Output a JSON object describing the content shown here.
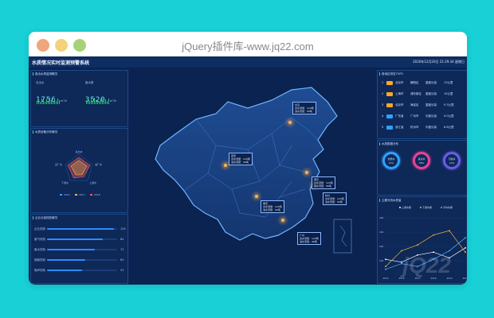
{
  "window": {
    "title": "jQuery插件库-www.jq22.com"
  },
  "header": {
    "title": "水质情况实时监测预警系统",
    "time": "2020年12月20日   21:29:34  星期日"
  },
  "left": {
    "panel1": {
      "title": "各出水质监测概况",
      "col1_label": "总出水",
      "col2_label": "废水数",
      "col1_value": "1756",
      "col1_unit": "m³/h",
      "col2_value": "3520",
      "col2_unit": "m³/h"
    },
    "panel2": {
      "title": "水质设备分布情况",
      "axes": [
        "总出水",
        "进厂水",
        "上游水",
        "下游水",
        "出厂水"
      ],
      "legend": [
        "2015",
        "2017",
        "2018"
      ]
    },
    "panel3": {
      "title": "企业污染排放情况",
      "rows": [
        {
          "label": "企业排放",
          "value": "100",
          "ratio": 0.95
        },
        {
          "label": "废气排放",
          "value": "84",
          "ratio": 0.8
        },
        {
          "label": "废水排放",
          "value": "72",
          "ratio": 0.68
        },
        {
          "label": "固废排放",
          "value": "60",
          "ratio": 0.55
        },
        {
          "label": "噪声排放",
          "value": "53",
          "ratio": 0.5
        }
      ]
    }
  },
  "map": {
    "callouts": [
      {
        "lines": [
          "北京",
          "出水流量：120吨",
          "进水流量：96吨"
        ]
      },
      {
        "lines": [
          "西安",
          "出水流量：120吨",
          "进水流量：96吨"
        ]
      },
      {
        "lines": [
          "南京",
          "出水流量：120吨",
          "进水流量：96吨"
        ]
      },
      {
        "lines": [
          "杭州",
          "出水流量：120吨",
          "进水流量：96吨"
        ]
      },
      {
        "lines": [
          "重庆",
          "出水流量：120吨",
          "进水流量：96吨"
        ]
      },
      {
        "lines": [
          "广州",
          "出水流量：120吨",
          "进水流量：96吨"
        ]
      }
    ]
  },
  "right": {
    "panel1": {
      "title": "各地区排名TOP5",
      "rows": [
        {
          "rank": "1",
          "a": "北京市",
          "b": "朝阳区",
          "c": "重度污染",
          "d": "13公里",
          "color": "#ffa726"
        },
        {
          "rank": "2",
          "a": "上海市",
          "b": "浦东新区",
          "c": "重度污染",
          "d": "10公里",
          "color": "#ffa726"
        },
        {
          "rank": "3",
          "a": "北京市",
          "b": "海淀区",
          "c": "重度污染",
          "d": "9.3公里",
          "color": "#ffa726"
        },
        {
          "rank": "4",
          "a": "广东省",
          "b": "广州市",
          "c": "中度污染",
          "d": "9.0公里",
          "color": "#2ea2ff"
        },
        {
          "rank": "5",
          "a": "浙江省",
          "b": "杭州市",
          "c": "中度污染",
          "d": "6.6公里",
          "color": "#2ea2ff"
        }
      ]
    },
    "panel2": {
      "title": "水质数据分布",
      "rings": [
        {
          "name": "优质水",
          "pct": "22%",
          "color": "#2ea2ff"
        },
        {
          "name": "良好水",
          "pct": "38%",
          "color": "#e84393"
        },
        {
          "name": "污染水",
          "pct": "10%",
          "color": "#6c5ce7"
        }
      ]
    },
    "panel3": {
      "title": "主要河流水质量",
      "legend": [
        "上游水质",
        "下游水质",
        "平均水质"
      ]
    }
  },
  "chart_data": {
    "type": "line",
    "title": "主要河流水质量",
    "x": [
      "2015",
      "2016",
      "2017",
      "2018",
      "2019",
      "2020"
    ],
    "ylim": [
      0,
      400
    ],
    "yticks": [
      "400",
      "300",
      "200",
      "100"
    ],
    "series": [
      {
        "name": "上游水质",
        "values": [
          110,
          90,
          140,
          160,
          120,
          190
        ],
        "color": "#ffffff"
      },
      {
        "name": "下游水质",
        "values": [
          60,
          170,
          210,
          280,
          310,
          160
        ],
        "color": "#f2b233"
      },
      {
        "name": "平均水质",
        "values": [
          40,
          80,
          60,
          110,
          170,
          260
        ],
        "color": "#4bb3ff"
      }
    ]
  }
}
